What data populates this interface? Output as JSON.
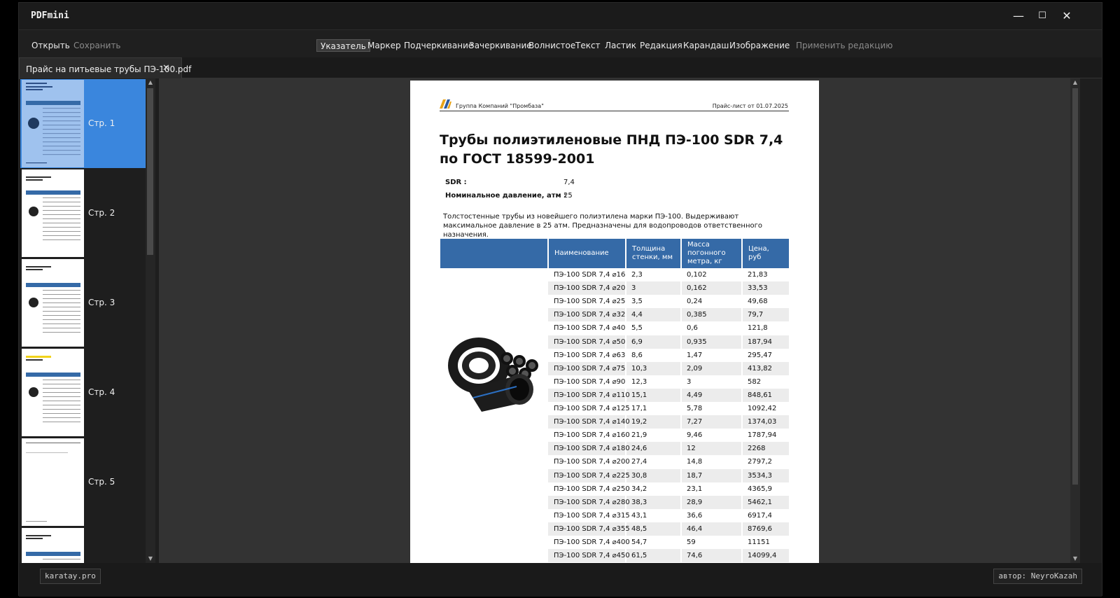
{
  "app": {
    "title": "PDFmini"
  },
  "window_controls": {
    "minimize": "—",
    "maximize": "☐",
    "close": "✕"
  },
  "toolbar": {
    "open": "Открыть",
    "save": "Сохранить",
    "tools": [
      "Указатель",
      "Маркер",
      "Подчеркивание",
      "Зачеркивание",
      "Волнистое",
      "Текст",
      "Ластик",
      "Редакция",
      "Карандаш",
      "Изображение"
    ],
    "active_tool": "Указатель",
    "apply_redaction": "Применить редакцию"
  },
  "tab": {
    "label": "Прайс на питьевые трубы ПЭ-100.pdf",
    "close_icon": "✕"
  },
  "thumbnails": [
    "Стр. 1",
    "Стр. 2",
    "Стр. 3",
    "Стр. 4",
    "Стр. 5"
  ],
  "document": {
    "company": "Группа Компаний \"Промбаза\"",
    "date": "Прайс-лист от 01.07.2025",
    "title_line1": "Трубы полиэтиленовые ПНД ПЭ-100 SDR 7,4",
    "title_line2": "по ГОСТ 18599-2001",
    "specs": [
      {
        "key": "SDR :",
        "value": "7,4"
      },
      {
        "key": "Номинальное давление, атм :",
        "value": "25"
      }
    ],
    "description": "Толстостенные трубы из новейшего полиэтилена марки ПЭ-100. Выдерживают максимальное давление в 25 атм. Предназначены для водопроводов ответственного назначения.",
    "table": {
      "headers": [
        "Наименование",
        "Толщина стенки, мм",
        "Масса погонного метра, кг",
        "Цена, руб"
      ],
      "rows": [
        [
          "ПЭ-100 SDR 7,4 ⌀16",
          "2,3",
          "0,102",
          "21,83"
        ],
        [
          "ПЭ-100 SDR 7,4 ⌀20",
          "3",
          "0,162",
          "33,53"
        ],
        [
          "ПЭ-100 SDR 7,4 ⌀25",
          "3,5",
          "0,24",
          "49,68"
        ],
        [
          "ПЭ-100 SDR 7,4 ⌀32",
          "4,4",
          "0,385",
          "79,7"
        ],
        [
          "ПЭ-100 SDR 7,4 ⌀40",
          "5,5",
          "0,6",
          "121,8"
        ],
        [
          "ПЭ-100 SDR 7,4 ⌀50",
          "6,9",
          "0,935",
          "187,94"
        ],
        [
          "ПЭ-100 SDR 7,4 ⌀63",
          "8,6",
          "1,47",
          "295,47"
        ],
        [
          "ПЭ-100 SDR 7,4 ⌀75",
          "10,3",
          "2,09",
          "413,82"
        ],
        [
          "ПЭ-100 SDR 7,4 ⌀90",
          "12,3",
          "3",
          "582"
        ],
        [
          "ПЭ-100 SDR 7,4 ⌀110",
          "15,1",
          "4,49",
          "848,61"
        ],
        [
          "ПЭ-100 SDR 7,4 ⌀125",
          "17,1",
          "5,78",
          "1092,42"
        ],
        [
          "ПЭ-100 SDR 7,4 ⌀140",
          "19,2",
          "7,27",
          "1374,03"
        ],
        [
          "ПЭ-100 SDR 7,4 ⌀160",
          "21,9",
          "9,46",
          "1787,94"
        ],
        [
          "ПЭ-100 SDR 7,4 ⌀180",
          "24,6",
          "12",
          "2268"
        ],
        [
          "ПЭ-100 SDR 7,4 ⌀200",
          "27,4",
          "14,8",
          "2797,2"
        ],
        [
          "ПЭ-100 SDR 7,4 ⌀225",
          "30,8",
          "18,7",
          "3534,3"
        ],
        [
          "ПЭ-100 SDR 7,4 ⌀250",
          "34,2",
          "23,1",
          "4365,9"
        ],
        [
          "ПЭ-100 SDR 7,4 ⌀280",
          "38,3",
          "28,9",
          "5462,1"
        ],
        [
          "ПЭ-100 SDR 7,4 ⌀315",
          "43,1",
          "36,6",
          "6917,4"
        ],
        [
          "ПЭ-100 SDR 7,4 ⌀355",
          "48,5",
          "46,4",
          "8769,6"
        ],
        [
          "ПЭ-100 SDR 7,4 ⌀400",
          "54,7",
          "59",
          "11151"
        ],
        [
          "ПЭ-100 SDR 7,4 ⌀450",
          "61,5",
          "74,6",
          "14099,4"
        ]
      ]
    }
  },
  "status": {
    "left": "karatay.pro",
    "right": "автор: NeyroKazah"
  },
  "colors": {
    "accent": "#3a86dd",
    "table_header": "#356aa7",
    "logo_blue": "#2c5aa0",
    "logo_orange": "#e8a317"
  }
}
